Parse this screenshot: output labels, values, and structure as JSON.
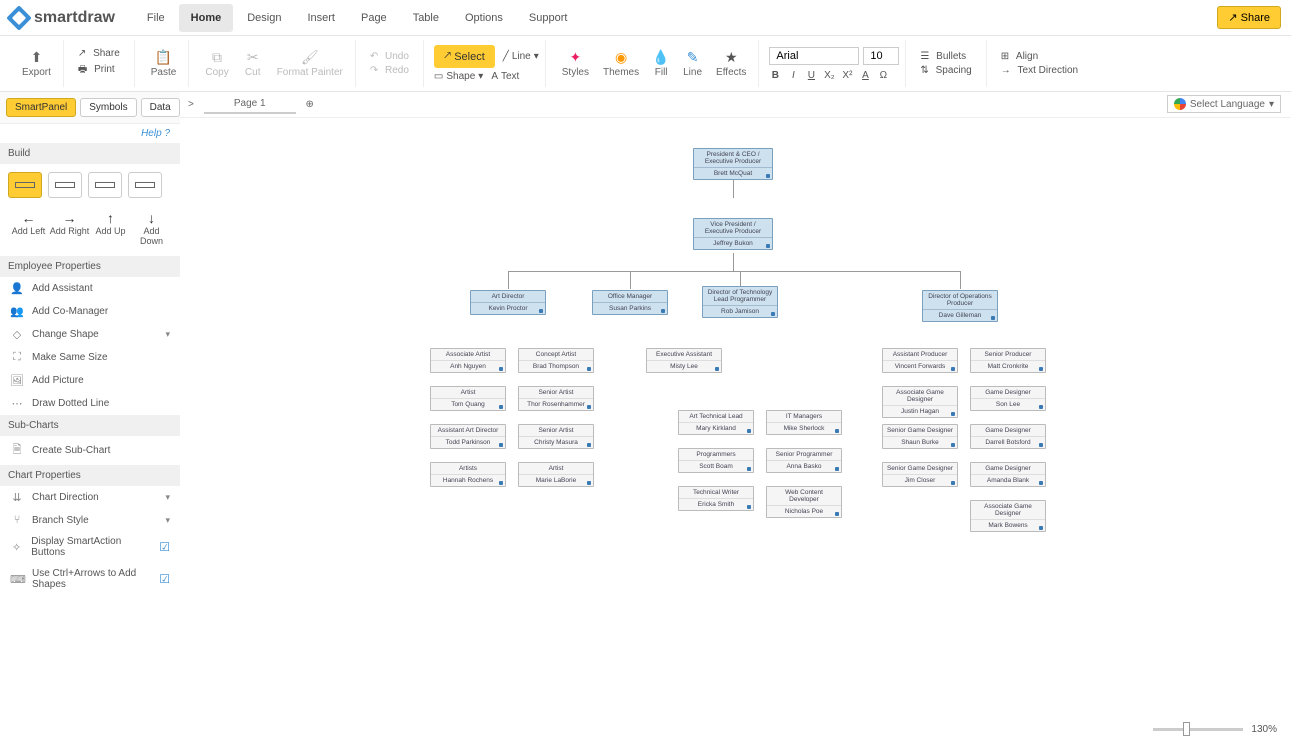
{
  "brand": "smartdraw",
  "menu": [
    "File",
    "Home",
    "Design",
    "Insert",
    "Page",
    "Table",
    "Options",
    "Support"
  ],
  "menu_active": 1,
  "share": "Share",
  "ribbon": {
    "export": "Export",
    "share": "Share",
    "print": "Print",
    "paste": "Paste",
    "copy": "Copy",
    "cut": "Cut",
    "format_painter": "Format Painter",
    "undo": "Undo",
    "redo": "Redo",
    "select": "Select",
    "shape": "Shape",
    "line": "Line",
    "text": "Text",
    "styles": "Styles",
    "themes": "Themes",
    "fill": "Fill",
    "line2": "Line",
    "effects": "Effects",
    "font": "Arial",
    "font_size": "10",
    "bullets": "Bullets",
    "spacing": "Spacing",
    "align": "Align",
    "text_direction": "Text Direction"
  },
  "panel": {
    "tabs": [
      "SmartPanel",
      "Symbols",
      "Data"
    ],
    "help": "Help",
    "build": "Build",
    "add": [
      "Add Left",
      "Add Right",
      "Add Up",
      "Add Down"
    ],
    "emp_props_hd": "Employee Properties",
    "emp_props": [
      "Add Assistant",
      "Add Co-Manager",
      "Change Shape",
      "Make Same Size",
      "Add Picture",
      "Draw Dotted Line"
    ],
    "sub_hd": "Sub-Charts",
    "sub": [
      "Create Sub-Chart"
    ],
    "chart_hd": "Chart Properties",
    "chart": [
      "Chart Direction",
      "Branch Style",
      "Display SmartAction Buttons",
      "Use Ctrl+Arrows to Add Shapes"
    ]
  },
  "page_name": "Page 1",
  "lang": "Select Language",
  "zoom": "130%",
  "org": {
    "n1": {
      "t": "President & CEO / Executive Producer",
      "n": "Brett McQuat"
    },
    "n2": {
      "t": "Vice President / Executive Producer",
      "n": "Jeffrey Bukon"
    },
    "n3": {
      "t": "Art Director",
      "n": "Kevin Proctor"
    },
    "n4": {
      "t": "Office Manager",
      "n": "Susan Parkins"
    },
    "n5": {
      "t": "Director of Technology Lead Programmer",
      "n": "Rob Jamison"
    },
    "n6": {
      "t": "Director of Operations Producer",
      "n": "Dave Gilleman"
    },
    "n3a": {
      "t": "Associate Artist",
      "n": "Anh Nguyen"
    },
    "n3b": {
      "t": "Artist",
      "n": "Tom Quang"
    },
    "n3c": {
      "t": "Assistant Art Director",
      "n": "Todd Parkinson"
    },
    "n3d": {
      "t": "Artists",
      "n": "Hannah Rochens"
    },
    "n3e": {
      "t": "Concept Artist",
      "n": "Brad Thompson"
    },
    "n3f": {
      "t": "Senior Artist",
      "n": "Thor Rosenhammer"
    },
    "n3g": {
      "t": "Senior Artist",
      "n": "Christy Masura"
    },
    "n3h": {
      "t": "Artist",
      "n": "Marie LaBorie"
    },
    "n4a": {
      "t": "Executive Assistant",
      "n": "Misty Lee"
    },
    "n5a": {
      "t": "Art Technical Lead",
      "n": "Mary Kirkland"
    },
    "n5b": {
      "t": "Programmers",
      "n": "Scott Boam"
    },
    "n5c": {
      "t": "Technical Writer",
      "n": "Ericka Smith"
    },
    "n5d": {
      "t": "IT Managers",
      "n": "Mike Sherlock"
    },
    "n5e": {
      "t": "Senior Programmer",
      "n": "Anna Basko"
    },
    "n5f": {
      "t": "Web Content Developer",
      "n": "Nicholas Poe"
    },
    "n6a": {
      "t": "Assistant Producer",
      "n": "Vincent Forwards"
    },
    "n6b": {
      "t": "Associate Game Designer",
      "n": "Justin Hagan"
    },
    "n6c": {
      "t": "Senior Game Designer",
      "n": "Shaun Burke"
    },
    "n6d": {
      "t": "Senior Game Designer",
      "n": "Jim Closer"
    },
    "n6e": {
      "t": "Senior Producer",
      "n": "Matt Cronkrite"
    },
    "n6f": {
      "t": "Game Designer",
      "n": "Son Lee"
    },
    "n6g": {
      "t": "Game Designer",
      "n": "Darrell Botsford"
    },
    "n6h": {
      "t": "Game Designer",
      "n": "Amanda Blank"
    },
    "n6i": {
      "t": "Associate Game Designer",
      "n": "Mark Bowens"
    }
  }
}
